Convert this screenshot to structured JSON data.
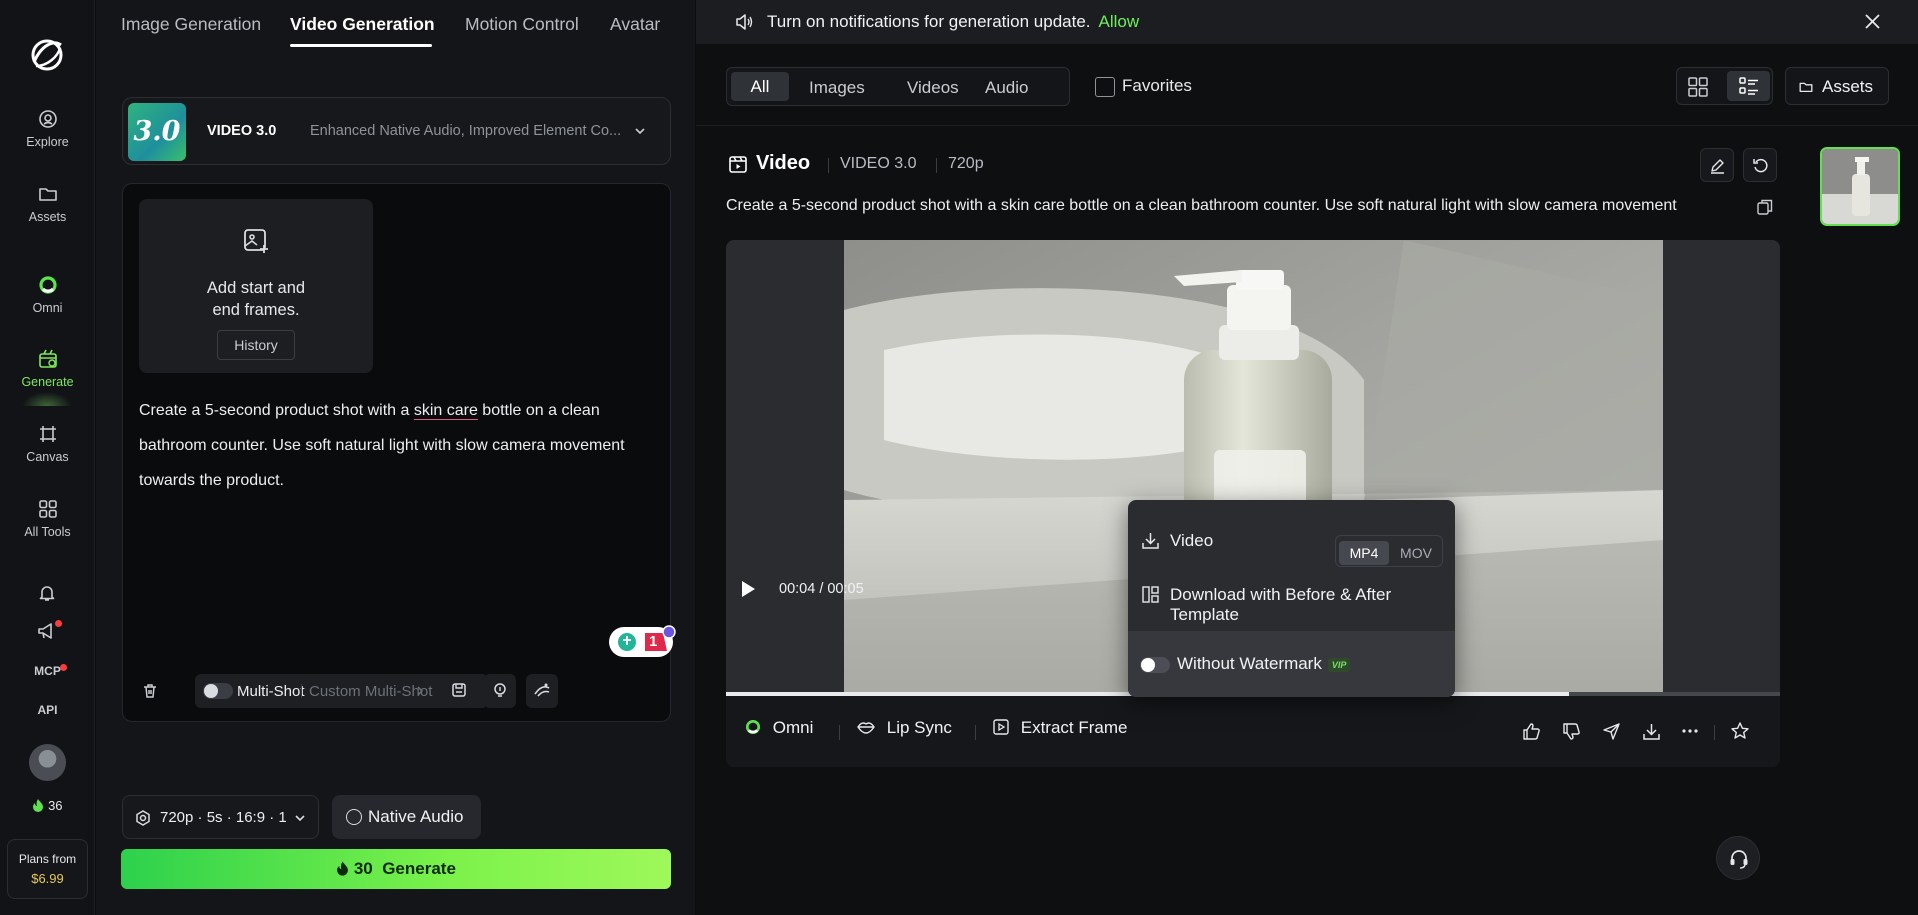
{
  "rail": {
    "items": [
      {
        "label": "Explore",
        "icon": "explore-icon"
      },
      {
        "label": "Assets",
        "icon": "folder-icon"
      },
      {
        "label": "Omni",
        "icon": "omni-icon"
      },
      {
        "label": "Generate",
        "icon": "generate-icon"
      },
      {
        "label": "Canvas",
        "icon": "canvas-icon"
      },
      {
        "label": "All Tools",
        "icon": "grid-icon"
      }
    ],
    "mcp": "MCP",
    "api": "API",
    "credits": "36",
    "plans_label": "Plans from",
    "plans_price": "$6.99"
  },
  "panel": {
    "tabs": [
      "Image Generation",
      "Video Generation",
      "Motion Control",
      "Avatar"
    ],
    "model": {
      "badge": "3.0",
      "name": "VIDEO 3.0",
      "description": "Enhanced Native Audio, Improved Element Co..."
    },
    "frames": {
      "line1": "Add start and",
      "line2": "end frames.",
      "history": "History"
    },
    "prompt": {
      "before": "Create a 5-second product shot with a ",
      "underlined": "skin care",
      "after": " bottle on a clean bathroom counter. Use soft natural light with slow camera movement towards the product."
    },
    "help_count": "1",
    "multishot": "Multi-Shot",
    "custom_multishot": "Custom Multi-Shot",
    "settings": "720p · 5s · 16:9 · 1",
    "native_audio": "Native Audio",
    "generate_cost": "30",
    "generate_label": "Generate"
  },
  "notification": {
    "text": "Turn on notifications for generation update.",
    "allow": "Allow"
  },
  "filters": [
    "All",
    "Images",
    "Videos",
    "Audio"
  ],
  "favorites": "Favorites",
  "assets": "Assets",
  "result": {
    "title": "Video",
    "model": "VIDEO 3.0",
    "resolution": "720p",
    "prompt": "Create a 5-second product shot with a skin care bottle on a clean bathroom counter. Use soft natural light with slow camera movement",
    "time": "00:04 / 00:05",
    "progress": 0.8
  },
  "download_menu": {
    "video": "Video",
    "formats": [
      "MP4",
      "MOV"
    ],
    "template": "Download with Before & After Template",
    "watermark": "Without Watermark",
    "vip": "VIP"
  },
  "actions": {
    "omni": "Omni",
    "lip_sync": "Lip Sync",
    "extract_frame": "Extract Frame"
  }
}
